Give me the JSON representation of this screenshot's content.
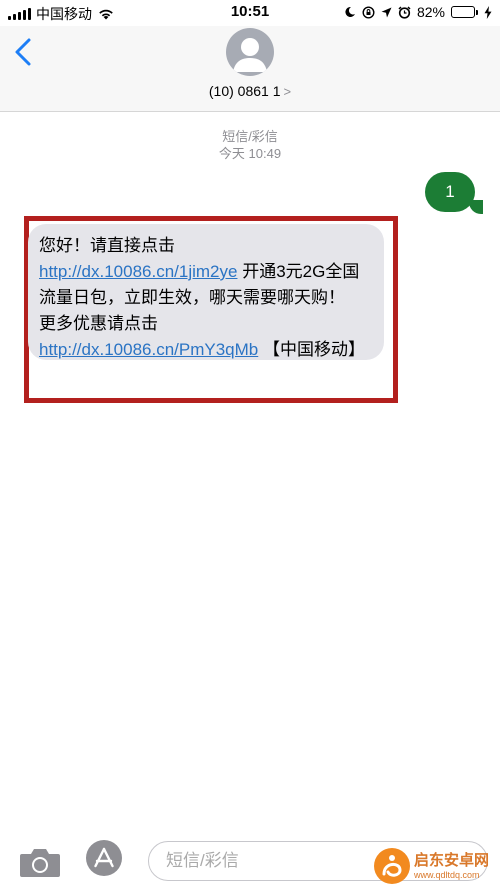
{
  "status_bar": {
    "carrier": "中国移动",
    "time": "10:51",
    "battery_percent": "82%",
    "battery_level": 0.82
  },
  "header": {
    "contact": "(10) 0861 1",
    "chevron": ">"
  },
  "meta": {
    "label": "短信/彩信",
    "timestamp": "今天 10:49"
  },
  "outgoing": {
    "text": "1",
    "color": "#1c7d35"
  },
  "incoming": {
    "greeting": "您好！请直接点击 ",
    "link1": "http://dx.10086.cn/1jim2ye",
    "middle": " 开通3元2G全国流量日包，立即生效，哪天需要哪天购！",
    "more": "更多优惠请点击 ",
    "link2": "http://dx.10086.cn/PmY3qMb",
    "signature": " 【中国移动】",
    "highlight_color": "#b3201e"
  },
  "input": {
    "placeholder": "短信/彩信"
  },
  "watermark": {
    "title": "启东安卓网",
    "url": "www.qdltdq.com"
  },
  "icons": [
    "signal-icon",
    "wifi-icon",
    "moon-icon",
    "lock-rotation-icon",
    "location-icon",
    "alarm-icon",
    "charging-icon",
    "back-chevron-icon",
    "avatar-icon",
    "camera-icon",
    "appstore-icon"
  ]
}
